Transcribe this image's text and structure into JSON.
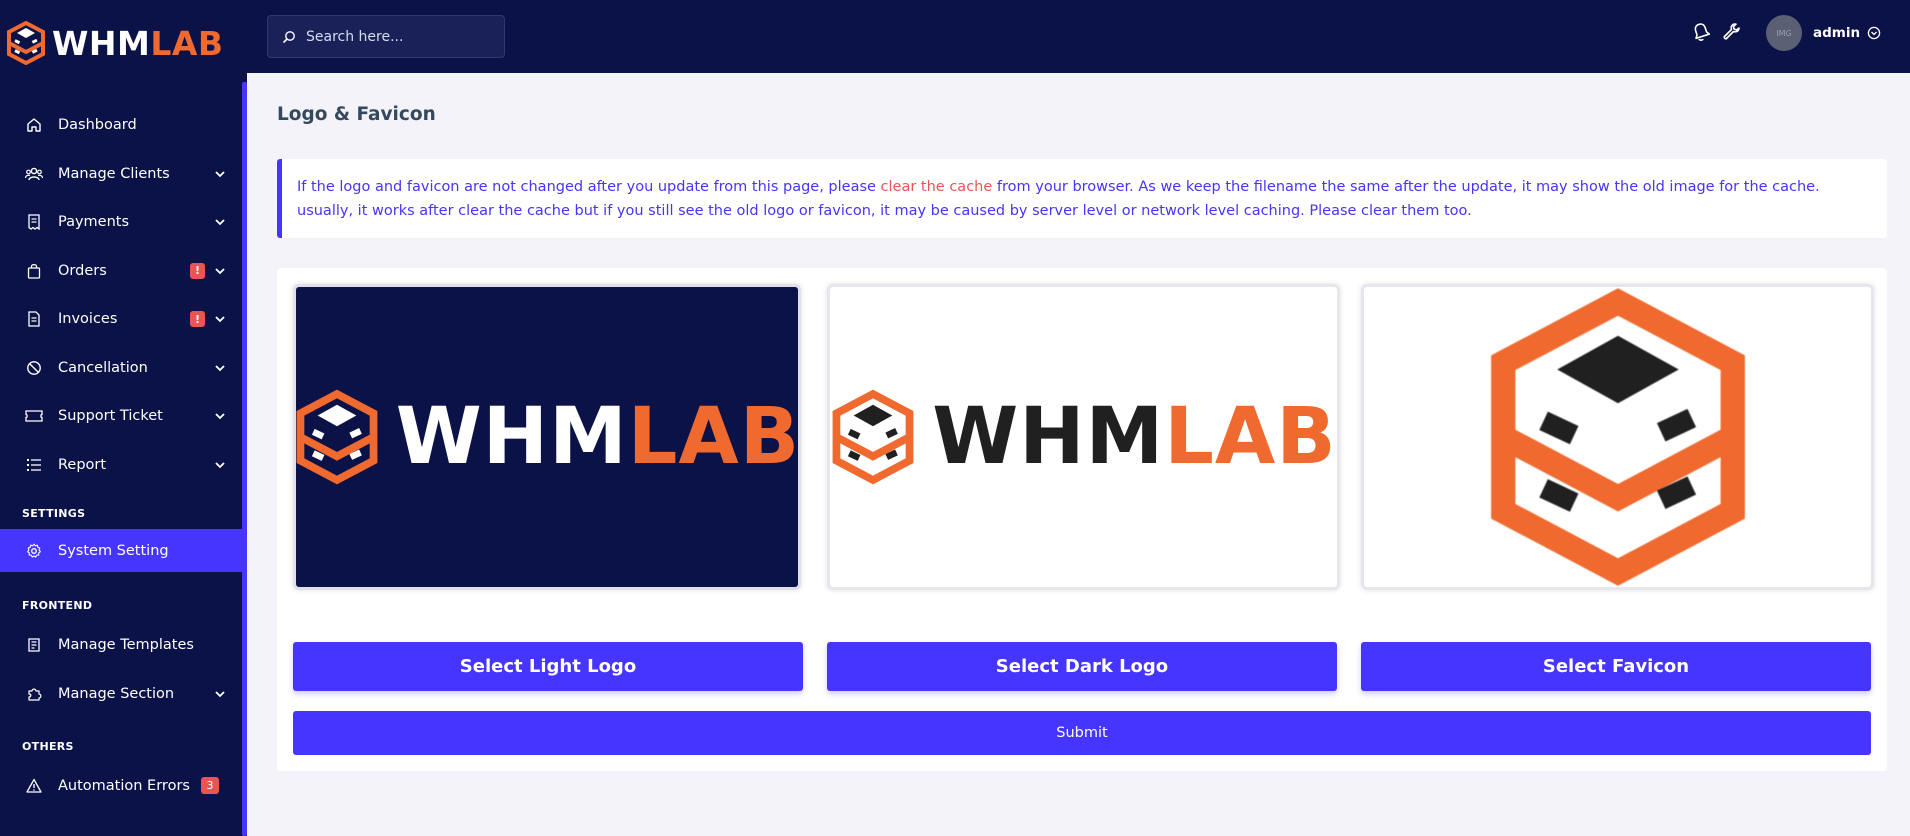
{
  "brand": {
    "part1": "WHM",
    "part2": "LAB"
  },
  "search": {
    "placeholder": "Search here..."
  },
  "topbar": {
    "user_name": "admin",
    "avatar_text": "IMG"
  },
  "sidebar": {
    "items": [
      {
        "label": "Dashboard",
        "icon": "home-icon"
      },
      {
        "label": "Manage Clients",
        "icon": "users-icon"
      },
      {
        "label": "Payments",
        "icon": "receipt-icon"
      },
      {
        "label": "Orders",
        "icon": "bag-icon",
        "badge": "!"
      },
      {
        "label": "Invoices",
        "icon": "file-icon",
        "badge": "!"
      },
      {
        "label": "Cancellation",
        "icon": "ban-icon"
      },
      {
        "label": "Support Ticket",
        "icon": "ticket-icon"
      },
      {
        "label": "Report",
        "icon": "list-icon"
      }
    ],
    "settings_heading": "SETTINGS",
    "system_setting": "System Setting",
    "frontend_heading": "FRONTEND",
    "manage_templates": "Manage Templates",
    "manage_section": "Manage Section",
    "others_heading": "OTHERS",
    "automation_errors": "Automation Errors",
    "automation_errors_count": "3"
  },
  "page": {
    "title": "Logo & Favicon",
    "notice_before": "If the logo and favicon are not changed after you update from this page, please ",
    "notice_link": "clear the cache",
    "notice_after": " from your browser. As we keep the filename the same after the update, it may show the old image for the cache. usually, it works after clear the cache but if you still see the old logo or favicon, it may be caused by server level or network level caching. Please clear them too.",
    "light_logo_word_1": "WHM",
    "light_logo_word_2": "LAB",
    "dark_logo_word_1": "WHM",
    "dark_logo_word_2": "LAB",
    "select_light_logo": "Select Light Logo",
    "select_dark_logo": "Select Dark Logo",
    "select_favicon": "Select Favicon",
    "submit": "Submit"
  },
  "colors": {
    "navy": "#0b1247",
    "primary": "#4634ff",
    "orange": "#f0692e",
    "danger": "#ea5455",
    "page_bg": "#f3f3f9"
  }
}
